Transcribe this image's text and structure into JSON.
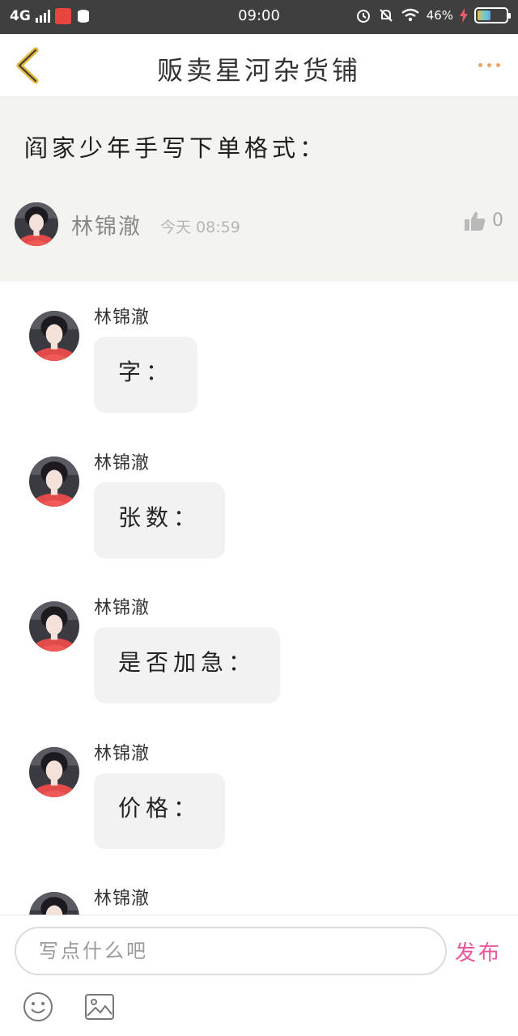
{
  "status_bar": {
    "network": "4G",
    "time": "09:00",
    "battery_percent": "46%",
    "battery_level": 0.46
  },
  "header": {
    "title": "贩卖星河杂货铺"
  },
  "post": {
    "text": "阎家少年手写下单格式：",
    "author": "林锦澈",
    "time": "今天 08:59",
    "likes": "0"
  },
  "comments": [
    {
      "author": "林锦澈",
      "text": "字："
    },
    {
      "author": "林锦澈",
      "text": "张数："
    },
    {
      "author": "林锦澈",
      "text": "是否加急："
    },
    {
      "author": "林锦澈",
      "text": "价格："
    },
    {
      "author": "林锦澈",
      "text": ""
    }
  ],
  "reply": {
    "placeholder": "写点什么吧",
    "value": "",
    "publish_label": "发布"
  },
  "icons": {
    "back": "chevron-left-icon",
    "more": "more-dots-icon",
    "like": "thumbs-up-icon",
    "emoji": "emoji-icon",
    "image": "image-icon"
  },
  "colors": {
    "status_bar_bg": "#3f3f3f",
    "post_bg": "#f3f3ef",
    "bubble_bg": "#f2f2f2",
    "publish": "#e8569c",
    "back_icon": "#e2b73a",
    "more_dots": "#f0a164"
  }
}
